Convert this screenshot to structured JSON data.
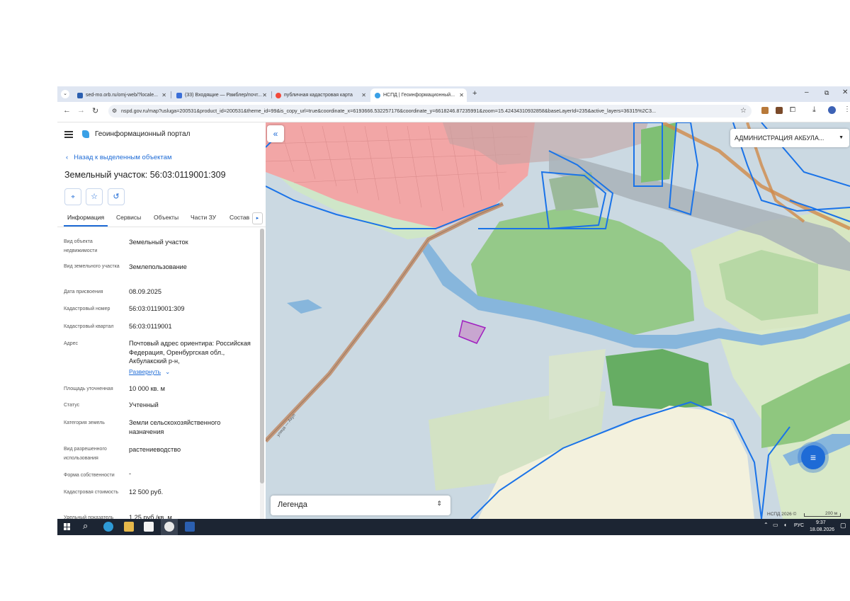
{
  "tabs": [
    {
      "label": "sed-mo.orb.ru/omj-web/?locale..."
    },
    {
      "label": "(33) Входящие — Рамблер/почт..."
    },
    {
      "label": "публичная кадастровая карта"
    },
    {
      "label": "НСПД | Геоинформационный..."
    }
  ],
  "new_tab_symbol": "+",
  "url": "nspd.gov.ru/map?usluga=200531&product_id=200531&theme_id=99&is_copy_url=true&coordinate_x=6193666.532257176&coordinate_y=6618246.87235991&zoom=15.42434310932858&baseLayerId=235&active_layers=36315%2C3...",
  "portal": {
    "title": "Геоинформационный портал"
  },
  "back_link": "Назад к выделенным объектам",
  "object_title": "Земельный участок: 56:03:0119001:309",
  "detail_tabs": [
    "Информация",
    "Сервисы",
    "Объекты",
    "Части ЗУ",
    "Состав"
  ],
  "fields": {
    "obj_type": {
      "label": "Вид объекта недвижимости",
      "value": "Земельный участок"
    },
    "land_type": {
      "label": "Вид земельного участка",
      "value": "Землепользование"
    },
    "assign_date": {
      "label": "Дата присвоения",
      "value": "08.09.2025"
    },
    "cad_number": {
      "label": "Кадастровый номер",
      "value": "56:03:0119001:309"
    },
    "cad_block": {
      "label": "Кадастровый квартал",
      "value": "56:03:0119001"
    },
    "address": {
      "label": "Адрес",
      "value": "Почтовый адрес ориентира: Российская Федерация, Оренбургская обл., Акбулакский р-н,"
    },
    "expand": "Развернуть",
    "area": {
      "label": "Площадь уточненная",
      "value": "10 000 кв. м"
    },
    "status": {
      "label": "Статус",
      "value": "Учтенный"
    },
    "category": {
      "label": "Категория земель",
      "value": "Земли сельскохозяйственного назначения"
    },
    "permitted_use": {
      "label": "Вид разрешенного использования",
      "value": "растениеводство"
    },
    "ownership": {
      "label": "Форма собственности",
      "value": "-"
    },
    "cad_value": {
      "label": "Кадастровая стоимость",
      "value": "12 500 руб."
    },
    "specific": {
      "label": "Удельный показатель",
      "value": "1,25 руб./кв. м"
    }
  },
  "map": {
    "admin_select": "АДМИНИСТРАЦИЯ АКБУЛА...",
    "legend": "Легенда",
    "attribution": "НСПД 2026 ©",
    "scale": "200 м",
    "road_label": "улица — Акул"
  },
  "taskbar": {
    "lang": "РУС",
    "time": "9:37",
    "date": "18.08.2026"
  },
  "colors": {
    "accent": "#1e6bd6",
    "parcel_outline": "#1a73e8",
    "selected_parcel": "#a020c0",
    "urban_zone": "#f2a6a6"
  }
}
